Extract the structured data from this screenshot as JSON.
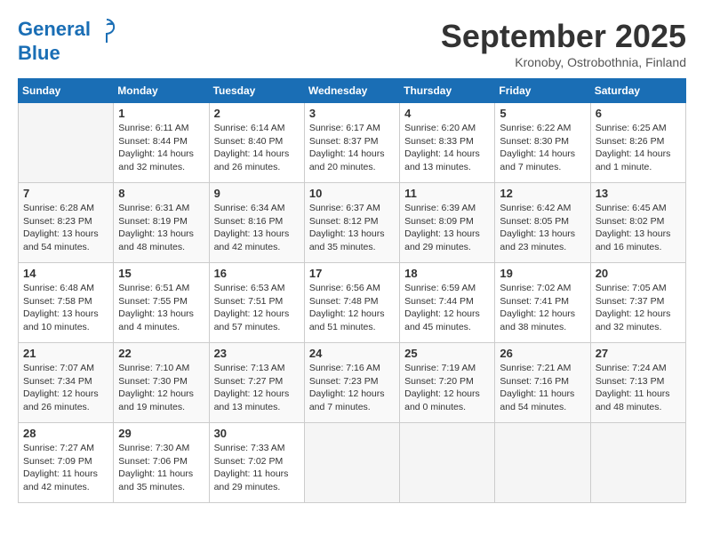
{
  "header": {
    "logo_line1": "General",
    "logo_line2": "Blue",
    "month": "September 2025",
    "location": "Kronoby, Ostrobothnia, Finland"
  },
  "days_of_week": [
    "Sunday",
    "Monday",
    "Tuesday",
    "Wednesday",
    "Thursday",
    "Friday",
    "Saturday"
  ],
  "weeks": [
    [
      {
        "day": "",
        "info": ""
      },
      {
        "day": "1",
        "info": "Sunrise: 6:11 AM\nSunset: 8:44 PM\nDaylight: 14 hours\nand 32 minutes."
      },
      {
        "day": "2",
        "info": "Sunrise: 6:14 AM\nSunset: 8:40 PM\nDaylight: 14 hours\nand 26 minutes."
      },
      {
        "day": "3",
        "info": "Sunrise: 6:17 AM\nSunset: 8:37 PM\nDaylight: 14 hours\nand 20 minutes."
      },
      {
        "day": "4",
        "info": "Sunrise: 6:20 AM\nSunset: 8:33 PM\nDaylight: 14 hours\nand 13 minutes."
      },
      {
        "day": "5",
        "info": "Sunrise: 6:22 AM\nSunset: 8:30 PM\nDaylight: 14 hours\nand 7 minutes."
      },
      {
        "day": "6",
        "info": "Sunrise: 6:25 AM\nSunset: 8:26 PM\nDaylight: 14 hours\nand 1 minute."
      }
    ],
    [
      {
        "day": "7",
        "info": "Sunrise: 6:28 AM\nSunset: 8:23 PM\nDaylight: 13 hours\nand 54 minutes."
      },
      {
        "day": "8",
        "info": "Sunrise: 6:31 AM\nSunset: 8:19 PM\nDaylight: 13 hours\nand 48 minutes."
      },
      {
        "day": "9",
        "info": "Sunrise: 6:34 AM\nSunset: 8:16 PM\nDaylight: 13 hours\nand 42 minutes."
      },
      {
        "day": "10",
        "info": "Sunrise: 6:37 AM\nSunset: 8:12 PM\nDaylight: 13 hours\nand 35 minutes."
      },
      {
        "day": "11",
        "info": "Sunrise: 6:39 AM\nSunset: 8:09 PM\nDaylight: 13 hours\nand 29 minutes."
      },
      {
        "day": "12",
        "info": "Sunrise: 6:42 AM\nSunset: 8:05 PM\nDaylight: 13 hours\nand 23 minutes."
      },
      {
        "day": "13",
        "info": "Sunrise: 6:45 AM\nSunset: 8:02 PM\nDaylight: 13 hours\nand 16 minutes."
      }
    ],
    [
      {
        "day": "14",
        "info": "Sunrise: 6:48 AM\nSunset: 7:58 PM\nDaylight: 13 hours\nand 10 minutes."
      },
      {
        "day": "15",
        "info": "Sunrise: 6:51 AM\nSunset: 7:55 PM\nDaylight: 13 hours\nand 4 minutes."
      },
      {
        "day": "16",
        "info": "Sunrise: 6:53 AM\nSunset: 7:51 PM\nDaylight: 12 hours\nand 57 minutes."
      },
      {
        "day": "17",
        "info": "Sunrise: 6:56 AM\nSunset: 7:48 PM\nDaylight: 12 hours\nand 51 minutes."
      },
      {
        "day": "18",
        "info": "Sunrise: 6:59 AM\nSunset: 7:44 PM\nDaylight: 12 hours\nand 45 minutes."
      },
      {
        "day": "19",
        "info": "Sunrise: 7:02 AM\nSunset: 7:41 PM\nDaylight: 12 hours\nand 38 minutes."
      },
      {
        "day": "20",
        "info": "Sunrise: 7:05 AM\nSunset: 7:37 PM\nDaylight: 12 hours\nand 32 minutes."
      }
    ],
    [
      {
        "day": "21",
        "info": "Sunrise: 7:07 AM\nSunset: 7:34 PM\nDaylight: 12 hours\nand 26 minutes."
      },
      {
        "day": "22",
        "info": "Sunrise: 7:10 AM\nSunset: 7:30 PM\nDaylight: 12 hours\nand 19 minutes."
      },
      {
        "day": "23",
        "info": "Sunrise: 7:13 AM\nSunset: 7:27 PM\nDaylight: 12 hours\nand 13 minutes."
      },
      {
        "day": "24",
        "info": "Sunrise: 7:16 AM\nSunset: 7:23 PM\nDaylight: 12 hours\nand 7 minutes."
      },
      {
        "day": "25",
        "info": "Sunrise: 7:19 AM\nSunset: 7:20 PM\nDaylight: 12 hours\nand 0 minutes."
      },
      {
        "day": "26",
        "info": "Sunrise: 7:21 AM\nSunset: 7:16 PM\nDaylight: 11 hours\nand 54 minutes."
      },
      {
        "day": "27",
        "info": "Sunrise: 7:24 AM\nSunset: 7:13 PM\nDaylight: 11 hours\nand 48 minutes."
      }
    ],
    [
      {
        "day": "28",
        "info": "Sunrise: 7:27 AM\nSunset: 7:09 PM\nDaylight: 11 hours\nand 42 minutes."
      },
      {
        "day": "29",
        "info": "Sunrise: 7:30 AM\nSunset: 7:06 PM\nDaylight: 11 hours\nand 35 minutes."
      },
      {
        "day": "30",
        "info": "Sunrise: 7:33 AM\nSunset: 7:02 PM\nDaylight: 11 hours\nand 29 minutes."
      },
      {
        "day": "",
        "info": ""
      },
      {
        "day": "",
        "info": ""
      },
      {
        "day": "",
        "info": ""
      },
      {
        "day": "",
        "info": ""
      }
    ]
  ]
}
